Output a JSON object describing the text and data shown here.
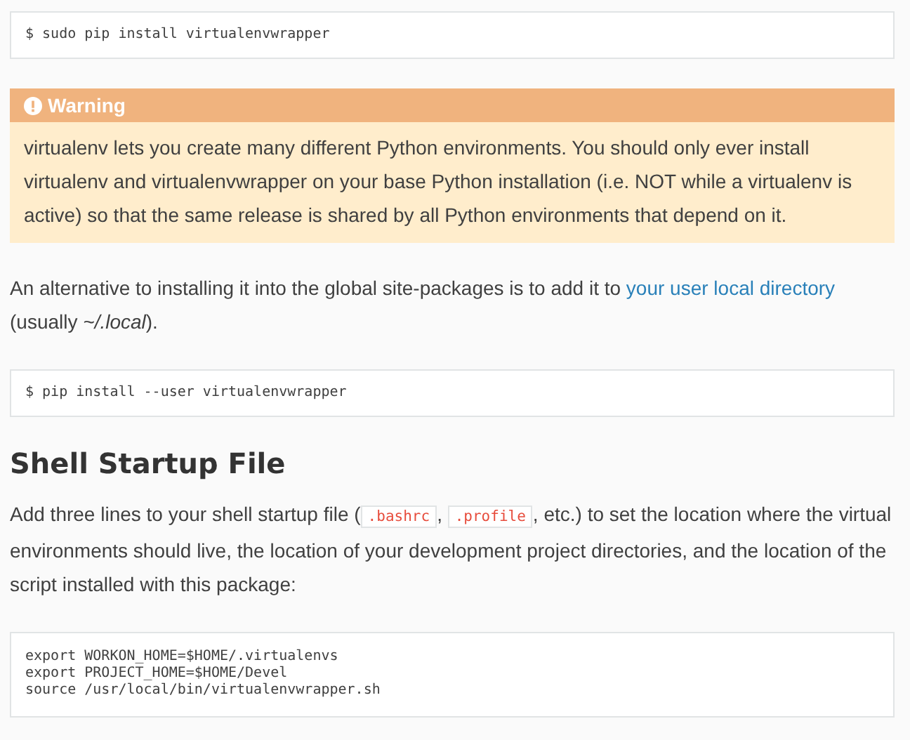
{
  "blocks": [
    {
      "kind": "code",
      "lines": [
        "$ sudo pip install virtualenvwrapper"
      ]
    },
    {
      "kind": "admonition",
      "title": "Warning",
      "text": "virtualenv lets you create many different Python environments. You should only ever install virtualenv and virtualenvwrapper on your base Python installation (i.e. NOT while a virtualenv is active) so that the same release is shared by all Python environments that depend on it."
    },
    {
      "kind": "paragraph",
      "parts": [
        {
          "kind": "text",
          "text": "An alternative to installing it into the global site-packages is to add it to "
        },
        {
          "kind": "link",
          "text": "your user local directory"
        },
        {
          "kind": "text",
          "text": " (usually "
        },
        {
          "kind": "italic",
          "text": "~/.local"
        },
        {
          "kind": "text",
          "text": ")."
        }
      ]
    },
    {
      "kind": "code",
      "lines": [
        "$ pip install --user virtualenvwrapper"
      ]
    },
    {
      "kind": "heading",
      "text": "Shell Startup File"
    },
    {
      "kind": "paragraph",
      "parts": [
        {
          "kind": "text",
          "text": "Add three lines to your shell startup file ("
        },
        {
          "kind": "code",
          "text": ".bashrc"
        },
        {
          "kind": "text",
          "text": ", "
        },
        {
          "kind": "code",
          "text": ".profile"
        },
        {
          "kind": "text",
          "text": ", etc.) to set the location where the virtual environments should live, the location of your development project directories, and the location of the script installed with this package:"
        }
      ]
    },
    {
      "kind": "code",
      "lines": [
        "export WORKON_HOME=$HOME/.virtualenvs",
        "export PROJECT_HOME=$HOME/Devel",
        "source /usr/local/bin/virtualenvwrapper.sh"
      ]
    }
  ]
}
